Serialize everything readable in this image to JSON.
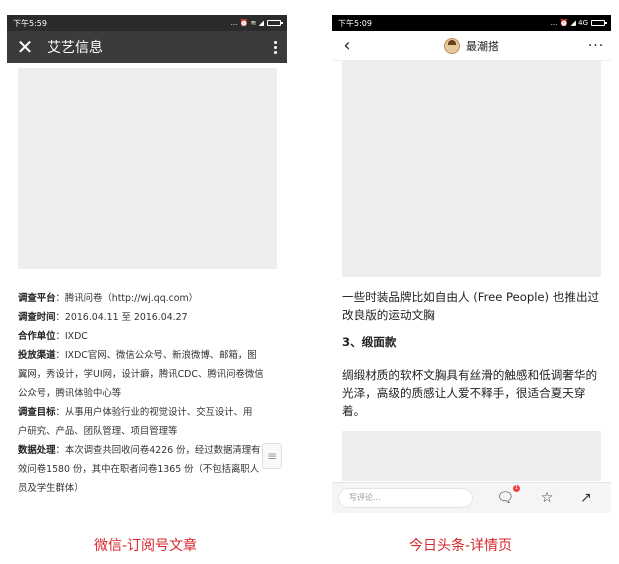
{
  "left": {
    "status_time": "下午5:59",
    "status_icons": "... ⏰ ≋ ◢",
    "title": "艾艺信息",
    "rows": [
      {
        "label": "调查平台",
        "text": "：腾讯问卷（http://wj.qq.com）"
      },
      {
        "label": "调查时间",
        "text": "：2016.04.11 至 2016.04.27"
      },
      {
        "label": "合作单位",
        "text": "：IXDC"
      },
      {
        "label": "投放渠道",
        "text": "：IXDC官网、微信公众号、新浪微博、邮箱，图"
      },
      {
        "label": "",
        "text": "翼网，秀设计，学UI网，设计癖，腾讯CDC、腾讯问卷微信"
      },
      {
        "label": "",
        "text": "公众号，腾讯体验中心等"
      },
      {
        "label": "调查目标",
        "text": "：从事用户体验行业的视觉设计、交互设计、用"
      },
      {
        "label": "",
        "text": "户研究、产品、团队管理、项目管理等"
      },
      {
        "label": "数据处理",
        "text": "：本次调查共回收问卷4226 份，经过数据清理有"
      },
      {
        "label": "",
        "text": "效问卷1580 份，其中在职者问卷1365 份（不包括离职人"
      },
      {
        "label": "",
        "text": "员及学生群体）"
      }
    ],
    "caption": "微信-订阅号文章"
  },
  "right": {
    "status_time": "下午5:09",
    "status_icons": "... ⏰ ◢ 4G",
    "author": "最潮搭",
    "p1": "一些时装品牌比如自由人 (Free People) 也推出过改良版的运动文胸",
    "h3": "3、缎面款",
    "p2": "绸缎材质的软杯文胸具有丝滑的触感和低调奢华的光泽，高级的质感让人爱不释手，很适合夏天穿着。",
    "comment_placeholder": "写评论...",
    "comment_badge": "1",
    "caption": "今日头条-详情页"
  }
}
